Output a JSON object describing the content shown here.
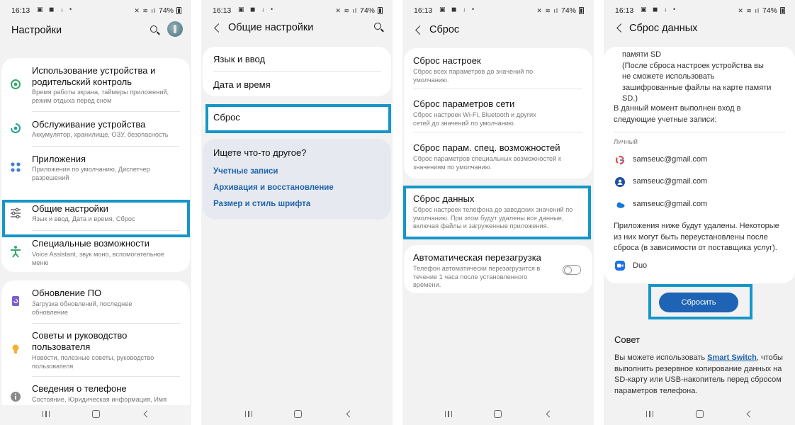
{
  "status": {
    "time": "16:13",
    "battery": "74%"
  },
  "screen1": {
    "title": "Настройки",
    "items": [
      {
        "icon": "device-care-leaf-icon",
        "title": "Использование устройства и родительский контроль",
        "subtitle": "Время работы экрана, таймеры приложений, режим отдыха перед сном"
      },
      {
        "icon": "maintenance-icon",
        "title": "Обслуживание устройства",
        "subtitle": "Аккумулятор, хранилище, ОЗУ, безопасность"
      },
      {
        "icon": "apps-grid-icon",
        "title": "Приложения",
        "subtitle": "Приложения по умолчанию, Диспетчер разрешений"
      },
      {
        "icon": "sliders-icon",
        "title": "Общие настройки",
        "subtitle": "Язык и ввод, Дата и время, Сброс"
      },
      {
        "icon": "accessibility-icon",
        "title": "Специальные возможности",
        "subtitle": "Voice Assistant, звук моно, вспомогательное меню"
      },
      {
        "icon": "software-update-icon",
        "title": "Обновление ПО",
        "subtitle": "Загрузка обновлений, последнее обновление"
      },
      {
        "icon": "tips-bulb-icon",
        "title": "Советы и руководство пользователя",
        "subtitle": "Новости, полезные советы, руководство пользователя"
      },
      {
        "icon": "info-icon",
        "title": "Сведения о телефоне",
        "subtitle": "Состояние, Юридическая информация, Имя"
      }
    ]
  },
  "screen2": {
    "title": "Общие настройки",
    "items": [
      "Язык и ввод",
      "Дата и время",
      "Сброс"
    ],
    "suggest_title": "Ищете что-то другое?",
    "links": [
      "Учетные записи",
      "Архивация и восстановление",
      "Размер и стиль шрифта"
    ]
  },
  "screen3": {
    "title": "Сброс",
    "items": [
      {
        "title": "Сброс настроек",
        "subtitle": "Сброс всех параметров до значений по умолчанию."
      },
      {
        "title": "Сброс параметров сети",
        "subtitle": "Сброс настроек Wi-Fi, Bluetooth и других сетей до значений по умолчанию."
      },
      {
        "title": "Сброс парам. спец. возможностей",
        "subtitle": "Сброс параметров специальных возможностей к значениям по умолчанию."
      },
      {
        "title": "Сброс данных",
        "subtitle": "Сброс настроек телефона до заводских значений по умолчанию. При этом будут удалены все данные, включая файлы и загруженные приложения."
      },
      {
        "title": "Автоматическая перезагрузка",
        "subtitle": "Телефон автоматически перезагрузится в течение 1 часа после установленного времени."
      }
    ]
  },
  "screen4": {
    "title": "Сброс данных",
    "sd_text": "памяти SD\n(После сброса настроек устройства вы не сможете использовать зашифрованные файлы на карте памяти SD.)",
    "accounts_intro": "В данный момент выполнен вход в следующие учетные записи:",
    "personal_label": "Личный",
    "accounts": [
      {
        "icon": "google-icon",
        "email": "samseuc@gmail.com",
        "color": "#e8453c"
      },
      {
        "icon": "samsung-account-icon",
        "email": "samseuc@gmail.com",
        "color": "#1f4fa3"
      },
      {
        "icon": "onedrive-cloud-icon",
        "email": "samseuc@gmail.com",
        "color": "#1479d8"
      }
    ],
    "apps_text": "Приложения ниже будут удалены. Некоторые из них могут быть переустановлены после сброса (в зависимости от поставщика услуг).",
    "app_name": "Duo",
    "reset_button": "Сбросить",
    "tip_title": "Совет",
    "tip_prefix": "Вы можете использовать ",
    "tip_link": "Smart Switch",
    "tip_suffix": ", чтобы выполнить резервное копирование данных на SD-карту или USB-накопитель перед сбросом параметров телефона."
  },
  "colors": {
    "highlight": "#1596c8",
    "link": "#1f62ab",
    "button": "#1f63b5"
  }
}
